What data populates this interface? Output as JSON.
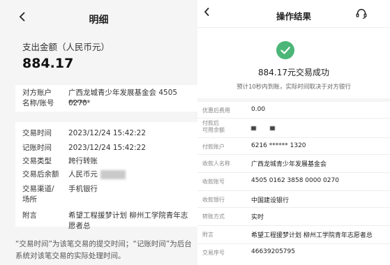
{
  "left": {
    "back_icon": "chevron-left-icon",
    "title": "明细",
    "amount_label": "支出金额（人民币元）",
    "amount": "884.17",
    "account": {
      "label_line1": "对方账户",
      "label_line2": "名称/账号",
      "value_line1": "广西龙城青少年发展基金会 4505 ******",
      "value_line2": "0270"
    },
    "rows": {
      "trade_time": {
        "label": "交易时间",
        "value": "2023/12/24   15:42:22"
      },
      "book_time": {
        "label": "记账时间",
        "value": "2023/12/24   15:42:22"
      },
      "trade_type": {
        "label": "交易类型",
        "value": "跨行转账"
      },
      "balance": {
        "label": "交易后余额",
        "value": "人民币元"
      },
      "channel": {
        "label_line1": "交易渠道/",
        "label_line2": "场所",
        "value": "手机银行"
      },
      "remark": {
        "label": "附言",
        "value": "希望工程援梦计划 柳州工学院青年志愿者总"
      }
    },
    "note": "“交易时间”为该笔交易的提交时间；“记账时间”为后台系统对该笔交易的实际处理时间。"
  },
  "right": {
    "back_icon": "chevron-left-icon",
    "title": "操作结果",
    "service_icon": "headset-icon",
    "success_icon": "check-circle-icon",
    "success_text": "884.17元交易成功",
    "success_sub": "预计10秒内到账，实际时间取决于对方银行",
    "rows": {
      "fee": {
        "label": "优惠后费用",
        "value": "0.00"
      },
      "available": {
        "label_line1": "付款后",
        "label_line2": "可用余额"
      },
      "payer": {
        "label": "付款账户",
        "value": "6216 ****** 1320"
      },
      "payee_name": {
        "label": "收款人名称",
        "value": "广西龙城青少年发展基金会"
      },
      "payee_account": {
        "label": "收款账号",
        "value": "4505 0162 3858 0000 0270"
      },
      "payee_bank": {
        "label": "收款银行",
        "value": "中国建设银行"
      },
      "method": {
        "label": "转账方式",
        "value": "实时"
      },
      "remark": {
        "label": "附言",
        "value": "希望工程援梦计划 柳州工学院青年志愿者总"
      },
      "serial": {
        "label": "交易序号",
        "value": "46639205795"
      }
    }
  },
  "colors": {
    "success_green": "#4bb677",
    "page_gray": "#f5f5f5"
  }
}
